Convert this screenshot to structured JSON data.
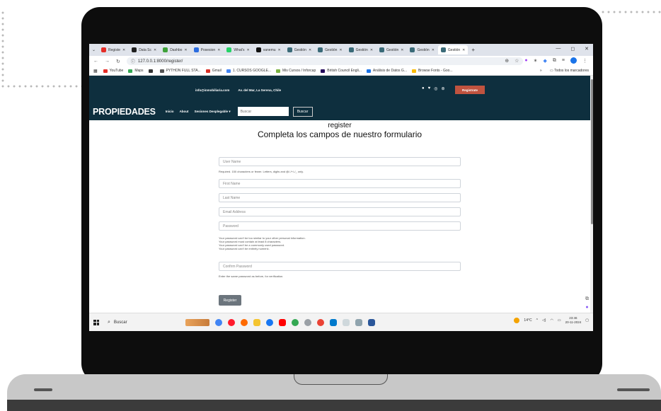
{
  "browser": {
    "tabs": [
      {
        "label": "Registe",
        "color": "#e52d27",
        "active": false
      },
      {
        "label": "Data Sc",
        "color": "#1f1f1f",
        "active": false
      },
      {
        "label": "Dashbo",
        "color": "#3fa13a",
        "active": false
      },
      {
        "label": "Posesion",
        "color": "#2b6ce0",
        "active": false
      },
      {
        "label": "What's",
        "color": "#25d366",
        "active": false
      },
      {
        "label": "vanemu",
        "color": "#111111",
        "active": false
      },
      {
        "label": "Gestión",
        "color": "#3a6a78",
        "active": false
      },
      {
        "label": "Gestión",
        "color": "#3a6a78",
        "active": false
      },
      {
        "label": "Gestión",
        "color": "#3a6a78",
        "active": false
      },
      {
        "label": "Gestión",
        "color": "#3a6a78",
        "active": false
      },
      {
        "label": "Gestión",
        "color": "#3a6a78",
        "active": false
      },
      {
        "label": "Gestión",
        "color": "#3a6a78",
        "active": true
      }
    ],
    "new_tab": "+",
    "window_controls": [
      "—",
      "◻",
      "✕"
    ],
    "url": "127.0.0.1:8000/register/",
    "bookmarks": [
      {
        "label": "YouTube",
        "color": "#e52d27"
      },
      {
        "label": "Maps",
        "color": "#34a853"
      },
      {
        "label": "",
        "color": "#333333"
      },
      {
        "label": "PYTHON FULL STA...",
        "color": "#555555"
      },
      {
        "label": "Gmail",
        "color": "#d93025"
      },
      {
        "label": "1. CURSOS GOOGLE...",
        "color": "#4285f4"
      },
      {
        "label": "Mis Cursos / Inforcap",
        "color": "#7cb342"
      },
      {
        "label": "British Council Engli...",
        "color": "#23085a"
      },
      {
        "label": "Análisis de Datos G...",
        "color": "#1a73e8"
      },
      {
        "label": "Browse Fonts - Goo...",
        "color": "#fbbc04"
      }
    ],
    "bookmarks_more": "»",
    "all_bookmarks": "Todos los marcadores"
  },
  "site": {
    "email": "info@inmobiliaria.com",
    "address": "Av. del Mar, La Serena, Chile",
    "register_top": "Registrate",
    "brand": "PROPIEDADES",
    "nav": [
      "Inicio",
      "About",
      "Sesiones Desplegable ▾"
    ],
    "search_placeholder": "Buscar",
    "search_button": "Buscar",
    "colors": {
      "navy": "#0e2f3e",
      "accent": "#c0533f"
    }
  },
  "form": {
    "heading": "register",
    "subheading": "Completa los campos de nuestro formulario",
    "username_placeholder": "User Name",
    "username_help": "Required. 150 characters or fewer. Letters, digits and @/./+/-/_ only.",
    "firstname_placeholder": "First Name",
    "lastname_placeholder": "Last Name",
    "email_placeholder": "Email Address",
    "password_placeholder": "Password",
    "password_help": [
      "Your password can't be too similar to your other personal information.",
      "Your password must contain at least 8 characters.",
      "Your password can't be a commonly used password.",
      "Your password can't be entirely numeric."
    ],
    "confirm_placeholder": "Confirm Password",
    "confirm_help": "Enter the same password as before, for verification.",
    "submit": "Register"
  },
  "taskbar": {
    "search": "Buscar",
    "weather": "14°C",
    "time": "23:46",
    "date": "20-11-2024"
  }
}
